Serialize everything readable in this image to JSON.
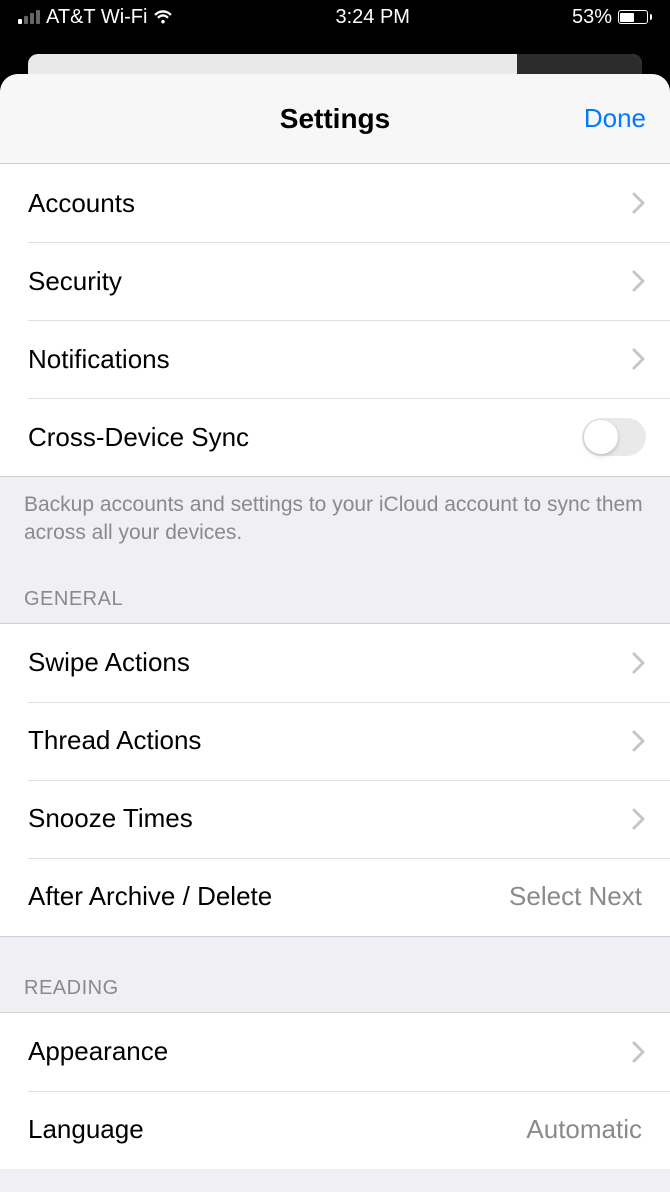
{
  "status": {
    "carrier": "AT&T Wi-Fi",
    "time": "3:24 PM",
    "battery_pct": "53%"
  },
  "nav": {
    "title": "Settings",
    "done": "Done"
  },
  "section1": {
    "accounts": "Accounts",
    "security": "Security",
    "notifications": "Notifications",
    "cross_device_sync": "Cross-Device Sync",
    "footer": "Backup accounts and settings to your iCloud account to sync them across all your devices."
  },
  "general": {
    "header": "General",
    "swipe_actions": "Swipe Actions",
    "thread_actions": "Thread Actions",
    "snooze_times": "Snooze Times",
    "after_archive": "After Archive / Delete",
    "after_archive_value": "Select Next"
  },
  "reading": {
    "header": "Reading",
    "appearance": "Appearance",
    "language": "Language",
    "language_value": "Automatic"
  }
}
